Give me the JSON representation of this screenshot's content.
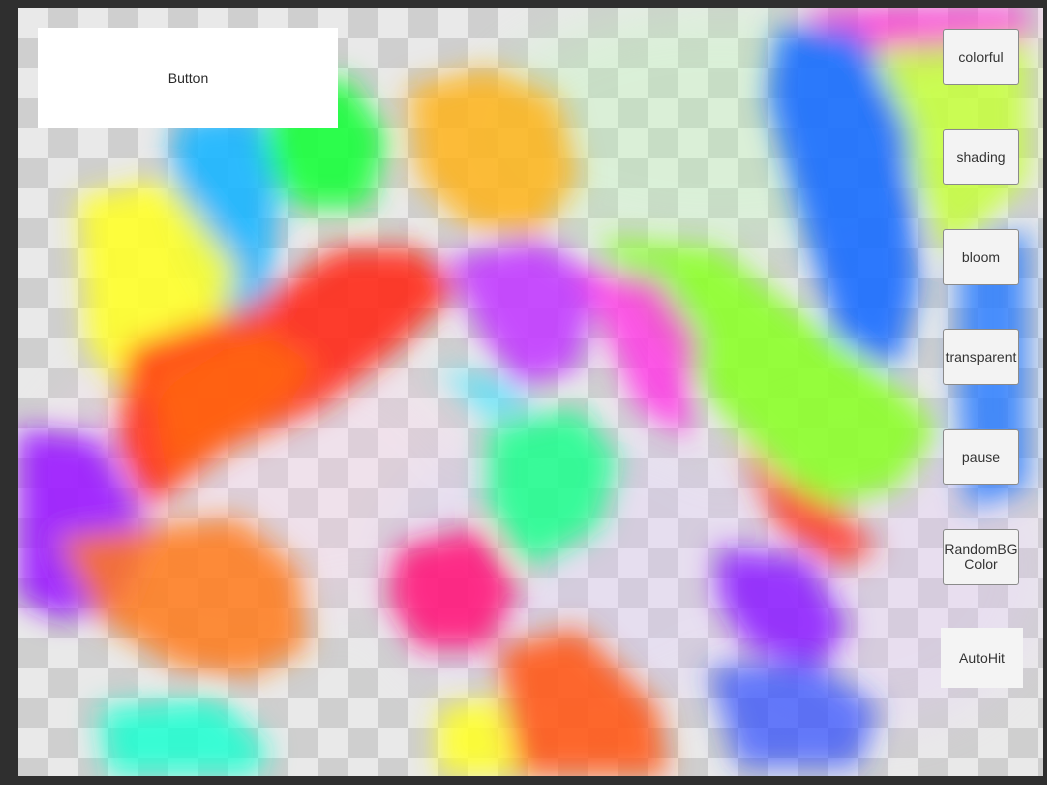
{
  "main_button": {
    "label": "Button"
  },
  "side_buttons": [
    {
      "id": "colorful",
      "label": "colorful"
    },
    {
      "id": "shading",
      "label": "shading"
    },
    {
      "id": "bloom",
      "label": "bloom"
    },
    {
      "id": "transparent",
      "label": "transparent"
    },
    {
      "id": "pause",
      "label": "pause"
    },
    {
      "id": "random-bg-color",
      "label": "RandomBG\nColor"
    },
    {
      "id": "auto-hit",
      "label": "AutoHit"
    }
  ],
  "colors": {
    "window_border": "#2f2f2f",
    "checker_light": "#e9e9e9",
    "checker_dark": "#cfcfcf",
    "button_bg": "#f3f3f3"
  }
}
